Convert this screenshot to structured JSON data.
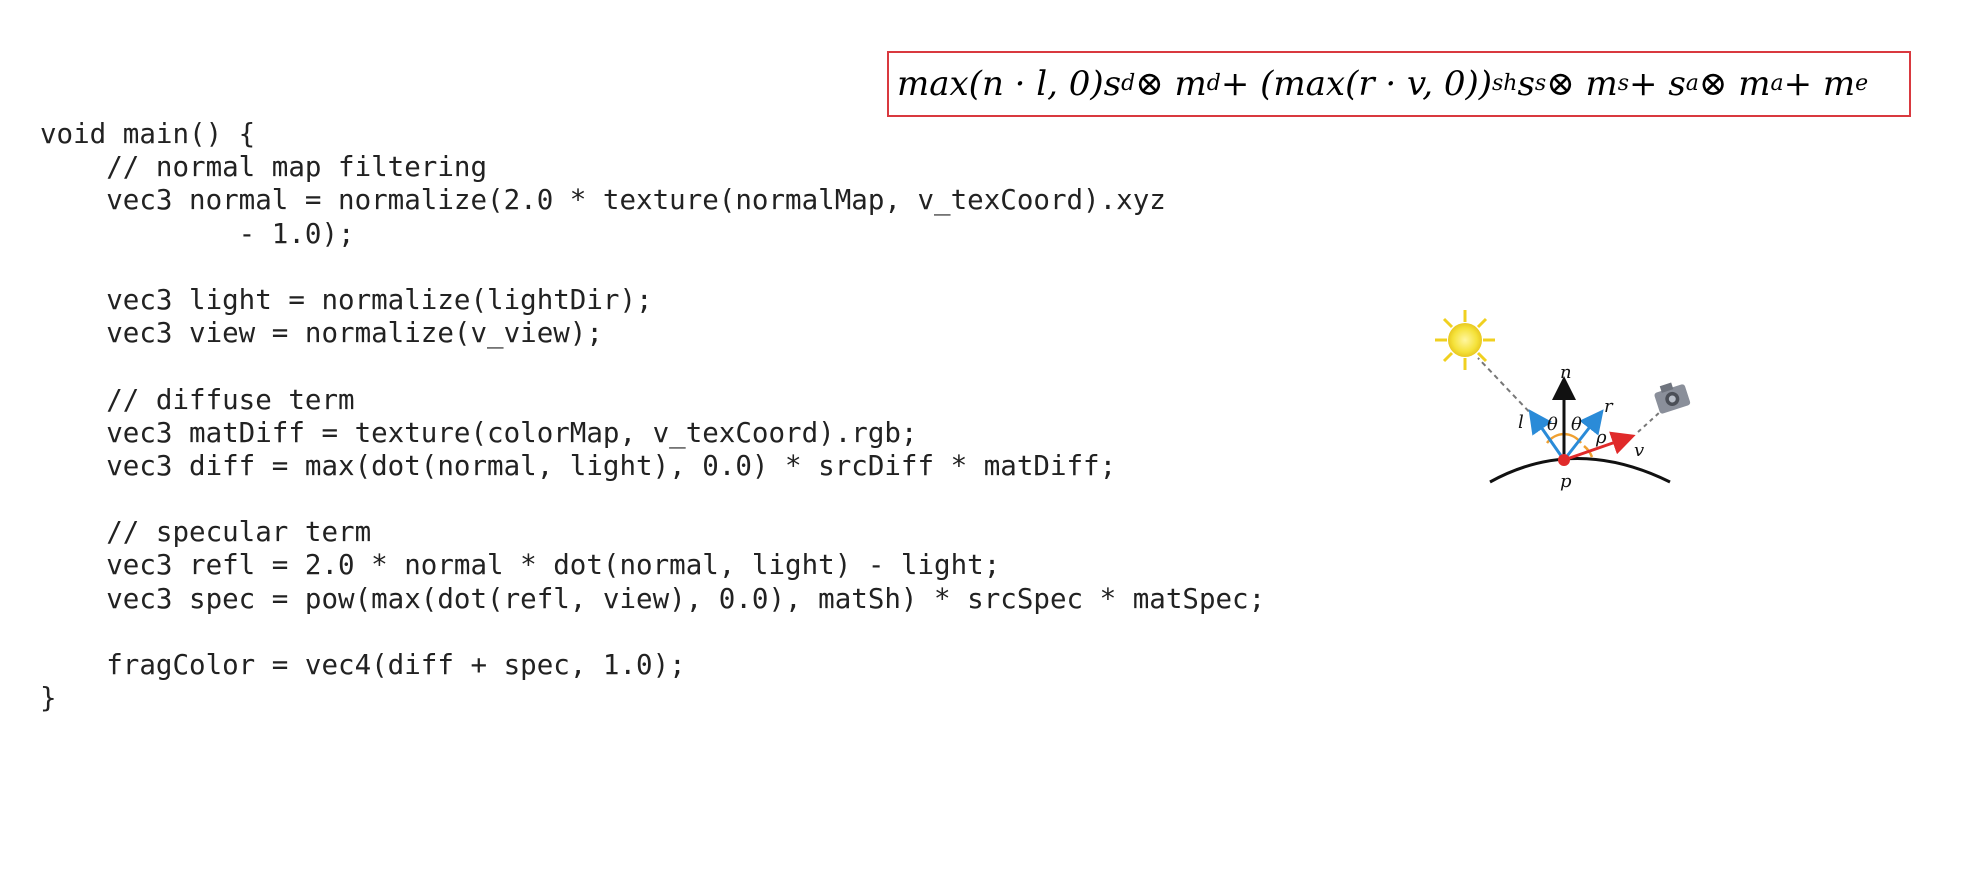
{
  "formula": {
    "parts": {
      "p1": "max(n · l, 0)s",
      "s1": "d",
      "p2": " ⊗ m",
      "s2": "d",
      "p3": " + (max(r · v, 0))",
      "sup": "sh",
      "p4": "s",
      "s3": "s",
      "p5": " ⊗ m",
      "s4": "s",
      "p6": " + s",
      "s5": "a",
      "p7": " ⊗ m",
      "s6": "a",
      "p8": " + m",
      "s7": "e"
    },
    "border_color": "#d9393f"
  },
  "code": {
    "lines": [
      "void main() {",
      "    // normal map filtering",
      "    vec3 normal = normalize(2.0 * texture(normalMap, v_texCoord).xyz",
      "            - 1.0);",
      "",
      "    vec3 light = normalize(lightDir);",
      "    vec3 view = normalize(v_view);",
      "",
      "    // diffuse term",
      "    vec3 matDiff = texture(colorMap, v_texCoord).rgb;",
      "    vec3 diff = max(dot(normal, light), 0.0) * srcDiff * matDiff;",
      "",
      "    // specular term",
      "    vec3 refl = 2.0 * normal * dot(normal, light) - light;",
      "    vec3 spec = pow(max(dot(refl, view), 0.0), matSh) * srcSpec * matSpec;",
      "",
      "    fragColor = vec4(diff + spec, 1.0);",
      "}"
    ]
  },
  "diagram": {
    "labels": {
      "n": "n",
      "l": "l",
      "r": "r",
      "v": "v",
      "p": "p",
      "theta_left": "θ",
      "theta_right": "θ",
      "rho": "ρ"
    },
    "icons": [
      "sun-icon",
      "camera-icon"
    ],
    "colors": {
      "normal": "#111111",
      "light_dir": "#2a8bd8",
      "reflect_dir": "#2a8bd8",
      "view_dir": "#e02a2a",
      "angle_arc": "#f0a030",
      "point": "#e02a2a",
      "sun": "#f5e23a",
      "camera": "#8a8f9a"
    }
  }
}
